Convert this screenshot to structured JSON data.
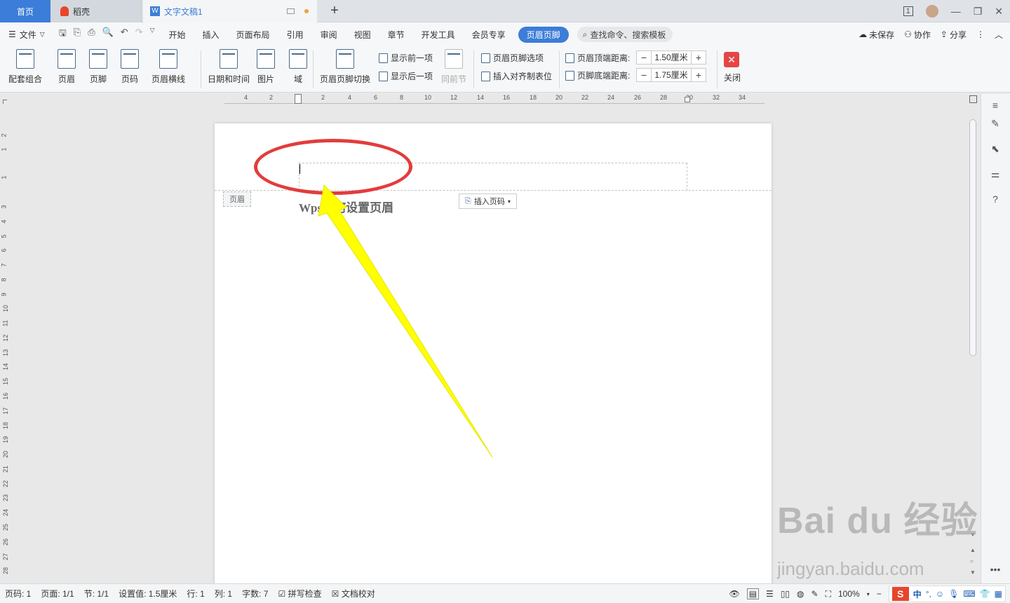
{
  "titlebar": {
    "home_tab": "首页",
    "daoke_tab": "稻壳",
    "doc_tab": "文字文稿1",
    "window_badge": "1"
  },
  "menubar": {
    "file": "文件",
    "items": [
      "开始",
      "插入",
      "页面布局",
      "引用",
      "审阅",
      "视图",
      "章节",
      "开发工具",
      "会员专享"
    ],
    "active": "页眉页脚",
    "search_placeholder": "查找命令、搜索模板",
    "unsaved": "未保存",
    "collab": "协作",
    "share": "分享"
  },
  "ribbon": {
    "combo": "配套组合",
    "header": "页眉",
    "footer": "页脚",
    "page_no": "页码",
    "header_line": "页眉横线",
    "datetime": "日期和时间",
    "picture": "图片",
    "field": "域",
    "switch": "页眉页脚切换",
    "show_prev": "显示前一项",
    "show_next": "显示后一项",
    "same_as_prev": "同前节",
    "hf_options": "页眉页脚选项",
    "insert_align_tab": "插入对齐制表位",
    "header_top_label": "页眉顶端距离:",
    "header_top_value": "1.50厘米",
    "footer_bottom_label": "页脚底端距离:",
    "footer_bottom_value": "1.75厘米",
    "close": "关闭"
  },
  "ruler": {
    "h_ticks": [
      "4",
      "2",
      "2",
      "4",
      "6",
      "8",
      "10",
      "12",
      "14",
      "16",
      "18",
      "20",
      "22",
      "24",
      "26",
      "28",
      "30",
      "32",
      "34"
    ],
    "v_ticks": [
      "2",
      "1",
      "1",
      "3",
      "4",
      "5",
      "6",
      "7",
      "8",
      "9",
      "10",
      "11",
      "12",
      "13",
      "14",
      "15",
      "16",
      "17",
      "18",
      "19",
      "20",
      "21",
      "22",
      "23",
      "24",
      "25",
      "26",
      "27",
      "28"
    ]
  },
  "document": {
    "header_tag": "页眉",
    "insert_page_no": "插入页码",
    "title": "Wps如何设置页眉"
  },
  "statusbar": {
    "page_no": "页码: 1",
    "pages": "页面: 1/1",
    "section": "节: 1/1",
    "setting": "设置值: 1.5厘米",
    "row": "行: 1",
    "col": "列: 1",
    "words": "字数: 7",
    "spell": "拼写检查",
    "proof": "文档校对",
    "zoom": "100%",
    "ime_lang": "中"
  },
  "watermark": {
    "brand": "Bai du 经验",
    "url": "jingyan.baidu.com"
  },
  "colors": {
    "accent": "#3b7dd8",
    "annotation_circle": "#e33c3c",
    "annotation_arrow": "#ffff00",
    "close": "#e54545"
  }
}
